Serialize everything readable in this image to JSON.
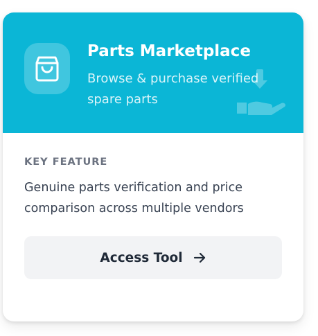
{
  "card": {
    "title": "Parts Marketplace",
    "subtitle": "Browse & purchase verified spare parts",
    "header_color": "#0bb6d6",
    "icon": "shopping-bag-icon",
    "watermark_icon": "hand-download-icon"
  },
  "feature": {
    "label": "KEY FEATURE",
    "description": "Genuine parts verification and price comparison across multiple vendors"
  },
  "action": {
    "label": "Access Tool",
    "icon": "arrow-right-icon"
  }
}
